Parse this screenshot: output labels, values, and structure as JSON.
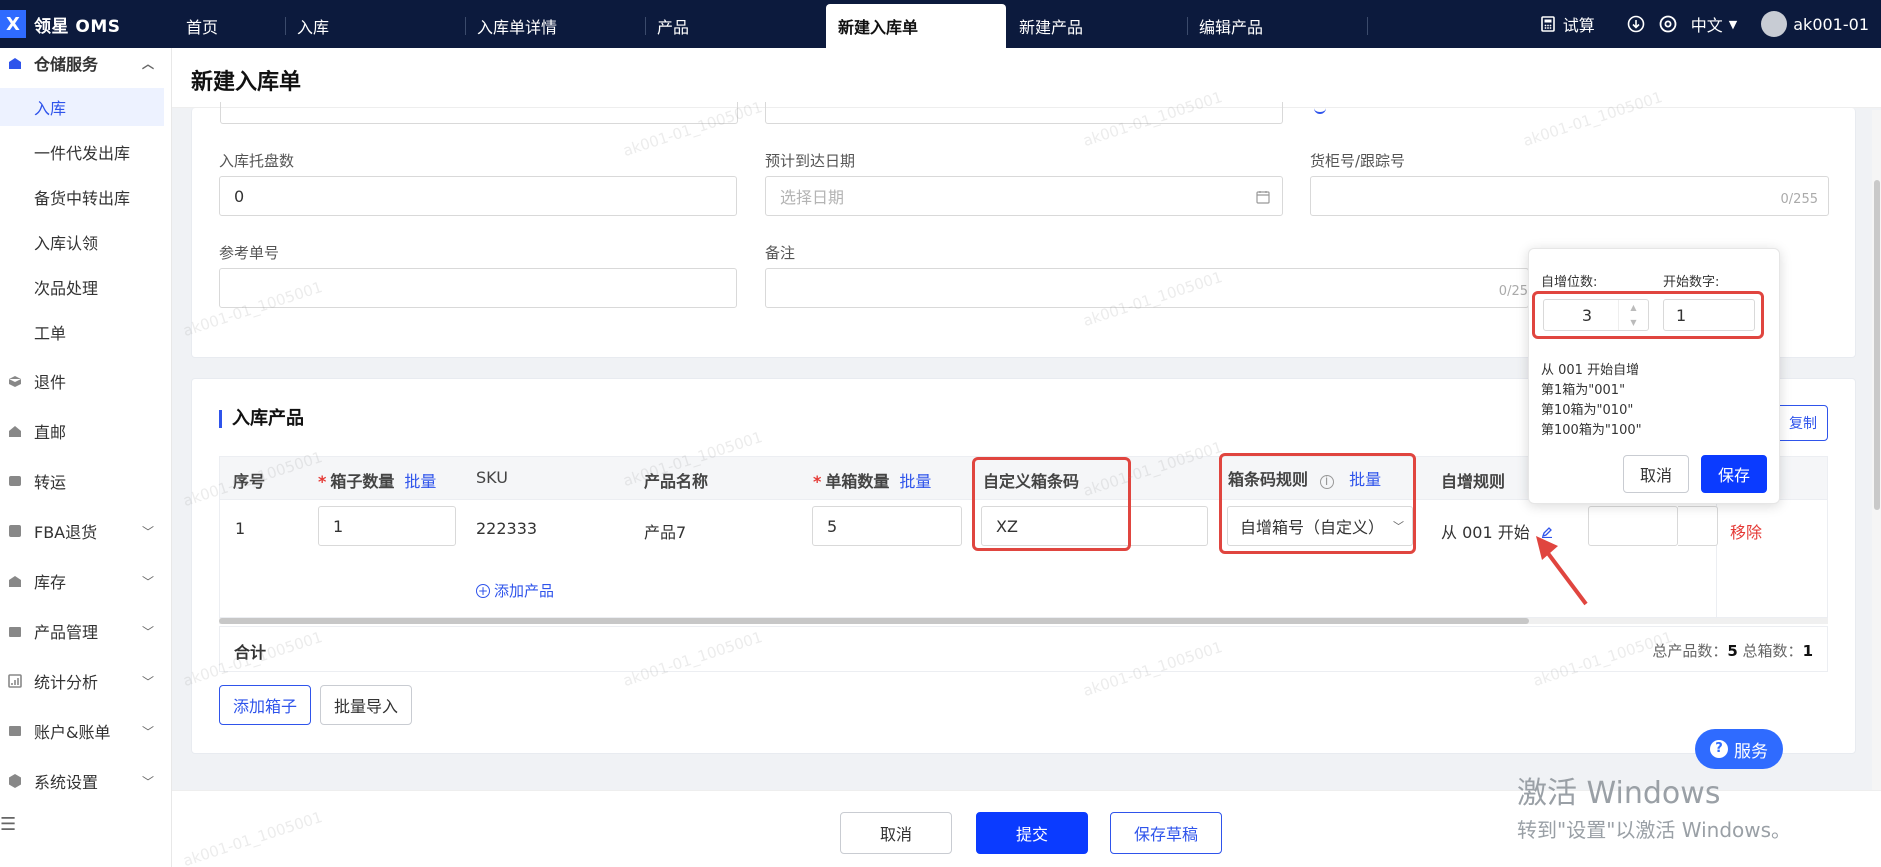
{
  "app": {
    "logo_text": "领星 OMS",
    "logo_letter": "X"
  },
  "top_nav": {
    "tabs": [
      "首页",
      "入库",
      "入库单详情",
      "产品",
      "新建入库单",
      "新建产品",
      "编辑产品"
    ],
    "active_tab": "新建入库单",
    "right": {
      "calc_label": "试算",
      "language": "中文",
      "user": "ak001-01"
    }
  },
  "sidebar": {
    "groups": [
      {
        "label": "仓储服务",
        "icon": "warehouse-icon",
        "expanded": true
      },
      {
        "label": "退件",
        "icon": "return-icon"
      },
      {
        "label": "直邮",
        "icon": "mail-icon"
      },
      {
        "label": "转运",
        "icon": "transfer-icon"
      },
      {
        "label": "FBA退货",
        "icon": "fba-icon"
      },
      {
        "label": "库存",
        "icon": "inventory-icon"
      },
      {
        "label": "产品管理",
        "icon": "product-icon"
      },
      {
        "label": "统计分析",
        "icon": "chart-icon"
      },
      {
        "label": "账户&账单",
        "icon": "account-icon"
      },
      {
        "label": "系统设置",
        "icon": "settings-icon"
      }
    ],
    "sub_items": [
      "入库",
      "一件代发出库",
      "备货中转出库",
      "入库认领",
      "次品处理",
      "工单"
    ],
    "active_sub": "入库"
  },
  "page": {
    "title": "新建入库单"
  },
  "form": {
    "pallet_count": {
      "label": "入库托盘数",
      "value": "0"
    },
    "eta": {
      "label": "预计到达日期",
      "placeholder": "选择日期"
    },
    "container_no": {
      "label": "货柜号/跟踪号",
      "counter": "0/255"
    },
    "ref_no": {
      "label": "参考单号"
    },
    "remark": {
      "label": "备注",
      "counter": "0/25"
    }
  },
  "products_section": {
    "title": "入库产品",
    "copy_button": "复制",
    "headers": {
      "seq": "序号",
      "box_qty": "箱子数量",
      "sku": "SKU",
      "name": "产品名称",
      "unit_qty": "单箱数量",
      "custom_code": "自定义箱条码",
      "code_rule": "箱条码规则",
      "auto_rule": "自增规则",
      "batch": "批量"
    },
    "row": {
      "seq": "1",
      "box_qty": "1",
      "sku": "222333",
      "name": "产品7",
      "unit_qty": "5",
      "custom_code": "XZ",
      "code_rule": "自增箱号（自定义）",
      "auto_rule": "从 001 开始",
      "remove": "移除"
    },
    "add_product": "添加产品",
    "summary": {
      "label": "合计",
      "total_products_label": "总产品数：",
      "total_products": "5",
      "total_boxes_label": "总箱数：",
      "total_boxes": "1"
    },
    "add_box": "添加箱子",
    "batch_import": "批量导入"
  },
  "popover": {
    "digits_label": "自增位数:",
    "digits_value": "3",
    "start_label": "开始数字:",
    "start_value": "1",
    "lines": [
      "从 001 开始自增",
      "第1箱为\"001\"",
      "第10箱为\"010\"",
      "第100箱为\"100\""
    ],
    "cancel": "取消",
    "save": "保存"
  },
  "footer": {
    "cancel": "取消",
    "submit": "提交",
    "save_draft": "保存草稿"
  },
  "service_button": "服务",
  "windows_activation": {
    "line1": "激活 Windows",
    "line2": "转到\"设置\"以激活 Windows。"
  },
  "watermark": "ak001-01_1005001",
  "colors": {
    "primary": "#0b3bff",
    "highlight": "#e0453f",
    "topbar": "#0c1a3d"
  }
}
